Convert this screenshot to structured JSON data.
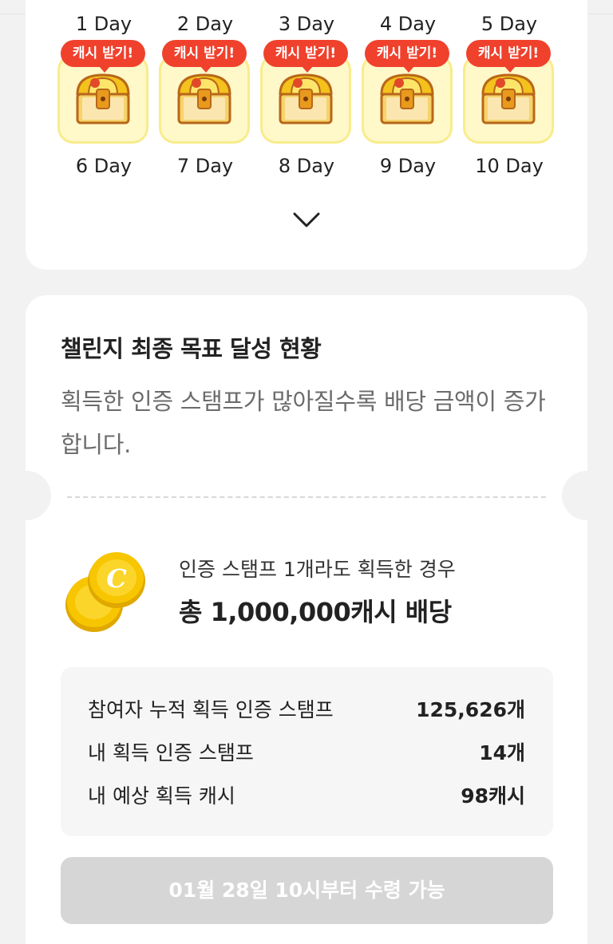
{
  "days_top": [
    "1 Day",
    "2 Day",
    "3 Day",
    "4 Day",
    "5 Day"
  ],
  "days_bottom": [
    "6 Day",
    "7 Day",
    "8 Day",
    "9 Day",
    "10 Day"
  ],
  "chests": [
    {
      "badge": "캐시 받기!"
    },
    {
      "badge": "캐시 받기!"
    },
    {
      "badge": "캐시 받기!"
    },
    {
      "badge": "캐시 받기!"
    },
    {
      "badge": "캐시 받기!"
    }
  ],
  "expand_icon": "chevron-down-icon",
  "status": {
    "title": "챌린지 최종 목표 달성 현황",
    "description": "획득한 인증 스탬프가 많아질수록 배당 금액이 증가합니다."
  },
  "reward": {
    "icon": "coin-icon",
    "condition": "인증 스탬프 1개라도 획득한 경우",
    "total": "총 1,000,000캐시 배당"
  },
  "stats": [
    {
      "label": "참여자 누적 획득 인증 스탬프",
      "value": "125,626개"
    },
    {
      "label": "내 획득 인증 스탬프",
      "value": "14개"
    },
    {
      "label": "내 예상 획득 캐시",
      "value": "98캐시"
    }
  ],
  "claim_button": "01월 28일 10시부터 수령 가능",
  "colors": {
    "badge_red": "#f0412d",
    "chest_bg": "#fff8c9",
    "button_disabled": "#d6d6d6",
    "coin_gold": "#f5c400"
  }
}
